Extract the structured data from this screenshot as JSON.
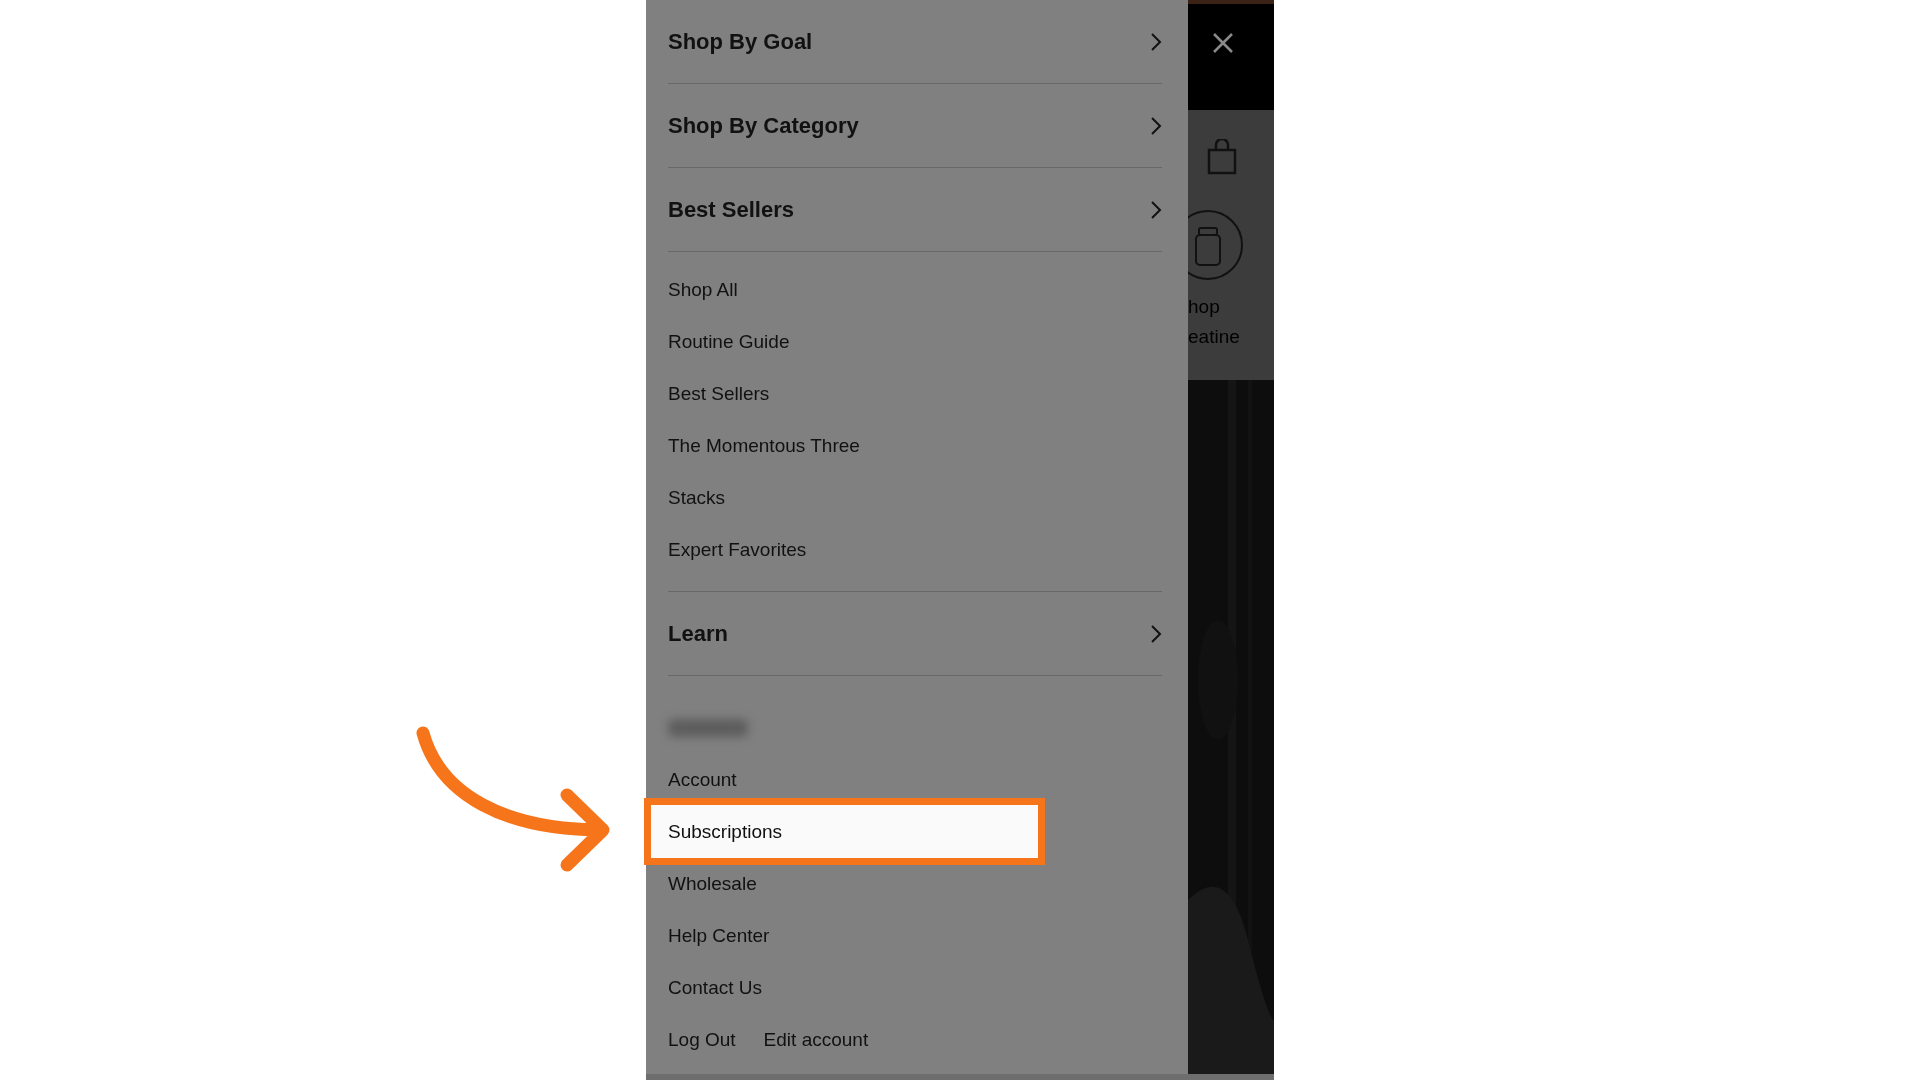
{
  "menu_items": [
    {
      "kind": "section",
      "label": "Shop By Goal"
    },
    {
      "kind": "section",
      "label": "Shop By Category"
    },
    {
      "kind": "section",
      "label": "Best Sellers"
    },
    {
      "kind": "link",
      "label": "Shop All"
    },
    {
      "kind": "link",
      "label": "Routine Guide"
    },
    {
      "kind": "link",
      "label": "Best Sellers"
    },
    {
      "kind": "link",
      "label": "The Momentous Three"
    },
    {
      "kind": "link",
      "label": "Stacks"
    },
    {
      "kind": "link",
      "label": "Expert Favorites"
    },
    {
      "kind": "section",
      "label": "Learn"
    }
  ],
  "account_links": [
    {
      "label": "Account",
      "highlighted": false
    },
    {
      "label": "Subscriptions",
      "highlighted": true
    },
    {
      "label": "Wholesale",
      "highlighted": false
    },
    {
      "label": "Help Center",
      "highlighted": false
    },
    {
      "label": "Contact Us",
      "highlighted": false
    }
  ],
  "footer_links": [
    "Log Out",
    "Edit account"
  ],
  "background_page": {
    "category_label_lines": [
      "hop",
      "eatine"
    ]
  }
}
